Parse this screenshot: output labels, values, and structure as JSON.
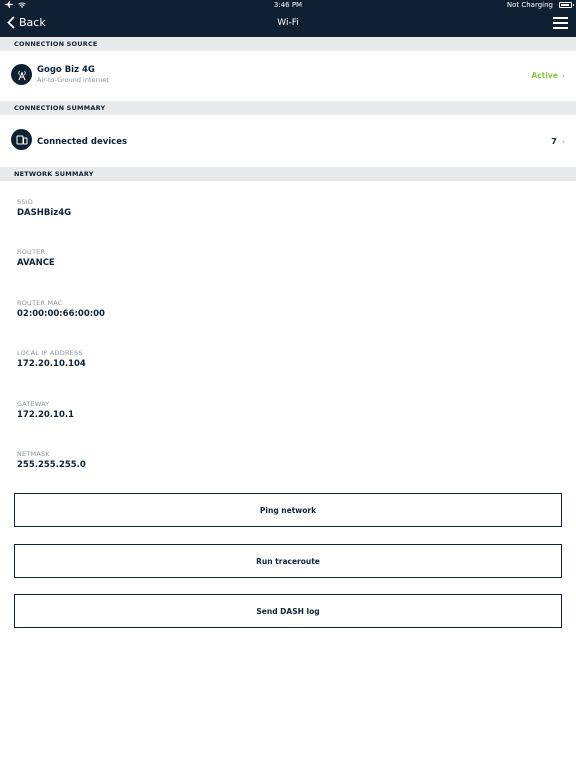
{
  "status_bar": {
    "time": "3:46 PM",
    "charging": "Not Charging"
  },
  "nav": {
    "back_label": "Back",
    "title": "Wi-Fi"
  },
  "connection_source": {
    "header": "CONNECTION SOURCE",
    "name": "Gogo Biz 4G",
    "subtitle": "Air-to-Ground internet",
    "status": "Active",
    "status_color": "#8cc43f"
  },
  "connection_summary": {
    "header": "CONNECTION SUMMARY",
    "label": "Connected devices",
    "count": "7"
  },
  "network_summary": {
    "header": "NETWORK SUMMARY",
    "items": [
      {
        "label": "SSID",
        "value": "DASHBiz4G"
      },
      {
        "label": "ROUTER",
        "value": "AVANCE"
      },
      {
        "label": "ROUTER MAC",
        "value": "02:00:00:66:00:00"
      },
      {
        "label": "LOCAL IP ADDRESS",
        "value": "172.20.10.104"
      },
      {
        "label": "GATEWAY",
        "value": "172.20.10.1"
      },
      {
        "label": "NETMASK",
        "value": "255.255.255.0"
      }
    ]
  },
  "actions": {
    "ping": "Ping network",
    "traceroute": "Run traceroute",
    "send_log": "Send DASH log"
  },
  "icons": {
    "airplane": "airplane-icon",
    "wifi": "wifi-icon",
    "battery": "battery-icon",
    "back": "chevron-left-icon",
    "menu": "hamburger-menu-icon",
    "tower": "antenna-tower-icon",
    "devices": "devices-icon",
    "chevron": "chevron-right-icon"
  },
  "colors": {
    "nav_bg": "#0f2033",
    "section_bg": "#e8e9ea",
    "active": "#8cc43f"
  }
}
